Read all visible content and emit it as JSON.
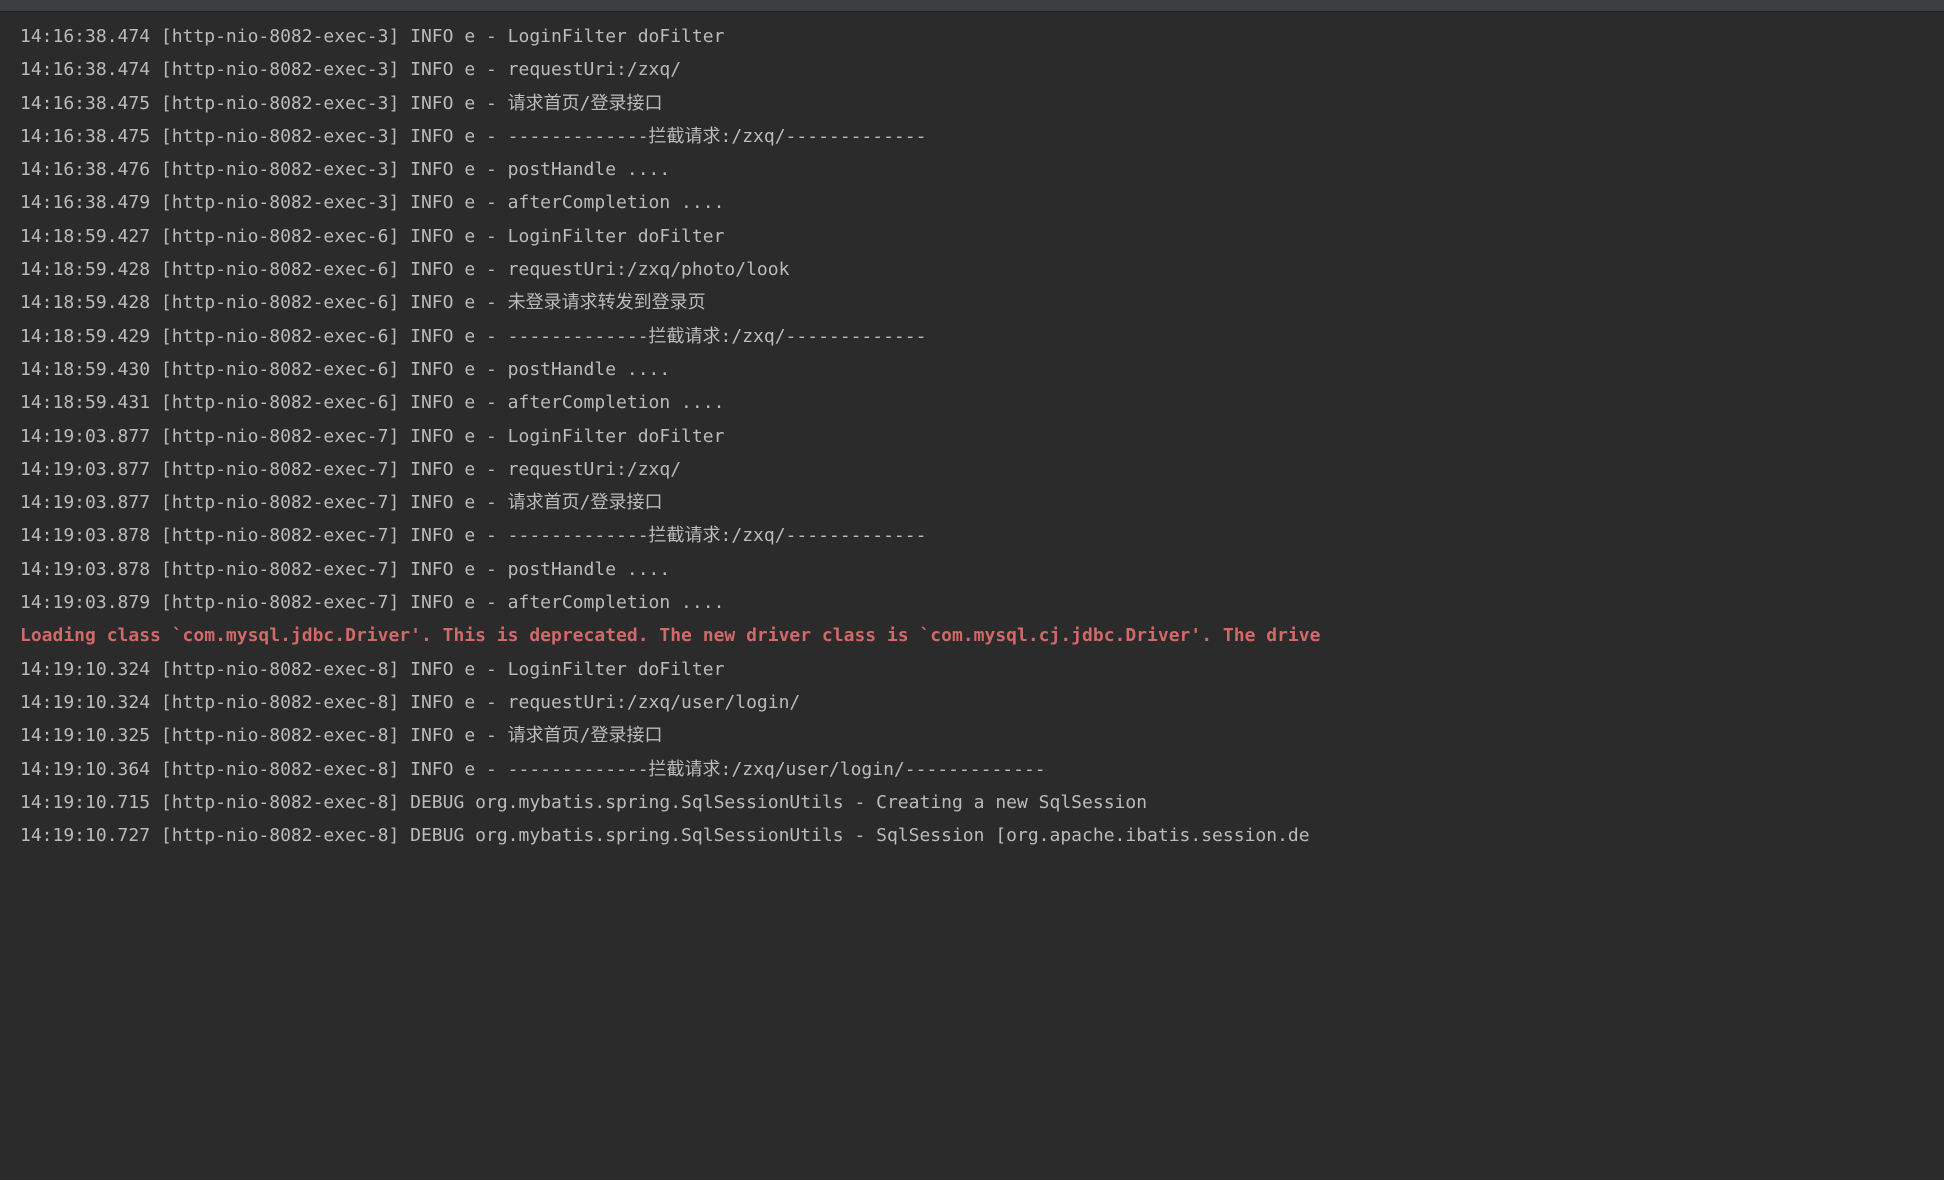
{
  "console": {
    "lines": [
      {
        "type": "info",
        "text": "14:16:38.474 [http-nio-8082-exec-3] INFO e - LoginFilter doFilter"
      },
      {
        "type": "info",
        "text": "14:16:38.474 [http-nio-8082-exec-3] INFO e - requestUri:/zxq/"
      },
      {
        "type": "info",
        "text": "14:16:38.475 [http-nio-8082-exec-3] INFO e - 请求首页/登录接口"
      },
      {
        "type": "info",
        "text": "14:16:38.475 [http-nio-8082-exec-3] INFO e - -------------拦截请求:/zxq/-------------"
      },
      {
        "type": "info",
        "text": "14:16:38.476 [http-nio-8082-exec-3] INFO e - postHandle ...."
      },
      {
        "type": "info",
        "text": "14:16:38.479 [http-nio-8082-exec-3] INFO e - afterCompletion ...."
      },
      {
        "type": "info",
        "text": "14:18:59.427 [http-nio-8082-exec-6] INFO e - LoginFilter doFilter"
      },
      {
        "type": "info",
        "text": "14:18:59.428 [http-nio-8082-exec-6] INFO e - requestUri:/zxq/photo/look"
      },
      {
        "type": "info",
        "text": "14:18:59.428 [http-nio-8082-exec-6] INFO e - 未登录请求转发到登录页"
      },
      {
        "type": "info",
        "text": "14:18:59.429 [http-nio-8082-exec-6] INFO e - -------------拦截请求:/zxq/-------------"
      },
      {
        "type": "info",
        "text": "14:18:59.430 [http-nio-8082-exec-6] INFO e - postHandle ...."
      },
      {
        "type": "info",
        "text": "14:18:59.431 [http-nio-8082-exec-6] INFO e - afterCompletion ...."
      },
      {
        "type": "info",
        "text": "14:19:03.877 [http-nio-8082-exec-7] INFO e - LoginFilter doFilter"
      },
      {
        "type": "info",
        "text": "14:19:03.877 [http-nio-8082-exec-7] INFO e - requestUri:/zxq/"
      },
      {
        "type": "info",
        "text": "14:19:03.877 [http-nio-8082-exec-7] INFO e - 请求首页/登录接口"
      },
      {
        "type": "info",
        "text": "14:19:03.878 [http-nio-8082-exec-7] INFO e - -------------拦截请求:/zxq/-------------"
      },
      {
        "type": "info",
        "text": "14:19:03.878 [http-nio-8082-exec-7] INFO e - postHandle ...."
      },
      {
        "type": "info",
        "text": "14:19:03.879 [http-nio-8082-exec-7] INFO e - afterCompletion ...."
      },
      {
        "type": "warning",
        "text": "Loading class `com.mysql.jdbc.Driver'. This is deprecated. The new driver class is `com.mysql.cj.jdbc.Driver'. The drive"
      },
      {
        "type": "info",
        "text": "14:19:10.324 [http-nio-8082-exec-8] INFO e - LoginFilter doFilter"
      },
      {
        "type": "info",
        "text": "14:19:10.324 [http-nio-8082-exec-8] INFO e - requestUri:/zxq/user/login/"
      },
      {
        "type": "info",
        "text": "14:19:10.325 [http-nio-8082-exec-8] INFO e - 请求首页/登录接口"
      },
      {
        "type": "info",
        "text": "14:19:10.364 [http-nio-8082-exec-8] INFO e - -------------拦截请求:/zxq/user/login/-------------"
      },
      {
        "type": "info",
        "text": "14:19:10.715 [http-nio-8082-exec-8] DEBUG org.mybatis.spring.SqlSessionUtils - Creating a new SqlSession"
      },
      {
        "type": "info",
        "text": "14:19:10.727 [http-nio-8082-exec-8] DEBUG org.mybatis.spring.SqlSessionUtils - SqlSession [org.apache.ibatis.session.de"
      }
    ]
  }
}
